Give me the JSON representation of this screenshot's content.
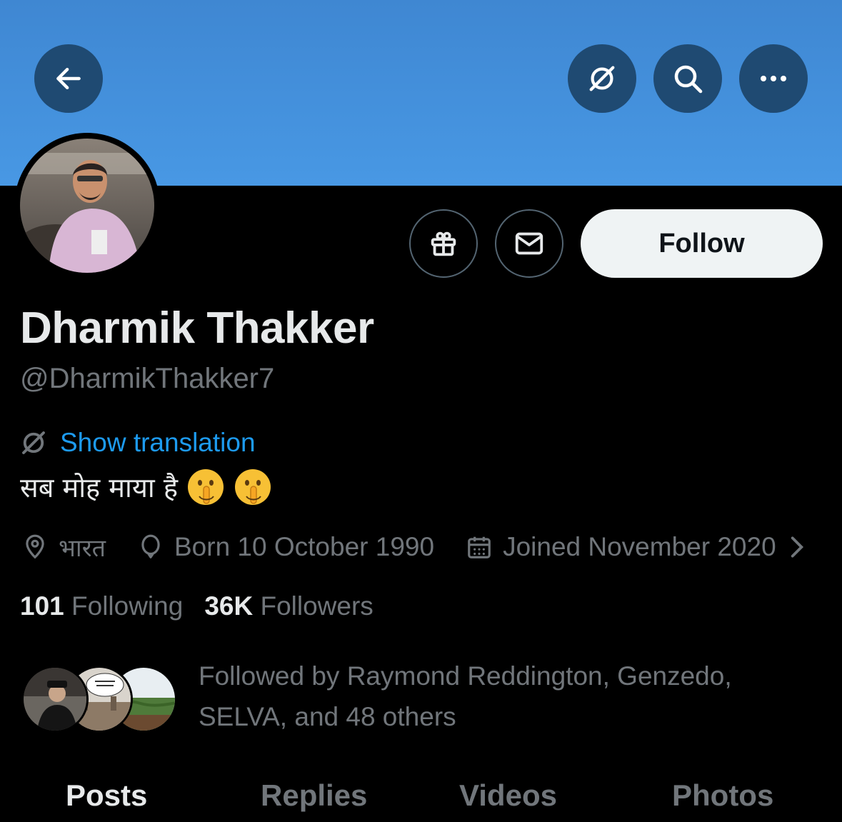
{
  "banner": {
    "color": "#4292dc"
  },
  "header": {
    "back_icon": "arrow-left-icon",
    "translate_icon": "translate-icon",
    "search_icon": "search-icon",
    "more_icon": "more-icon"
  },
  "actions": {
    "gift_icon": "gift-icon",
    "message_icon": "mail-icon",
    "follow_label": "Follow"
  },
  "profile": {
    "display_name": "Dharmik Thakker",
    "handle": "@DharmikThakker7",
    "translation_link": "Show translation",
    "bio_text": "सब मोह माया है",
    "bio_emoji": [
      "shushing-face",
      "shushing-face"
    ],
    "location": "भारत",
    "birthday": "Born 10 October 1990",
    "joined": "Joined November 2020"
  },
  "stats": {
    "following_count": "101",
    "following_label": "Following",
    "followers_count": "36K",
    "followers_label": "Followers"
  },
  "followed_by": {
    "text": "Followed by Raymond Reddington, Genzedo, SELVA, and 48 others"
  },
  "tabs": [
    {
      "label": "Posts",
      "active": true
    },
    {
      "label": "Replies",
      "active": false
    },
    {
      "label": "Videos",
      "active": false
    },
    {
      "label": "Photos",
      "active": false
    }
  ],
  "colors": {
    "accent": "#1d9bf0",
    "header_button": "#1f4a72",
    "follow_button": "#eff3f4"
  }
}
